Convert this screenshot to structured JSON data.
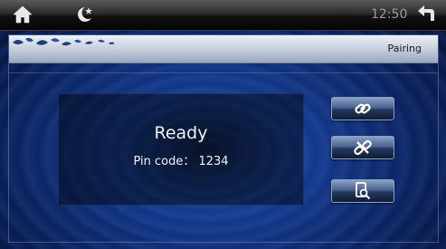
{
  "statusbar": {
    "time": "12:50",
    "icons": [
      "home-icon",
      "night-mode-icon",
      "back-arrow-icon"
    ]
  },
  "header": {
    "title": "Pairing"
  },
  "pairing": {
    "status": "Ready",
    "pin_text": "Pin code： 1234"
  },
  "actions": [
    {
      "name": "pair",
      "icon": "link-icon"
    },
    {
      "name": "unpair",
      "icon": "unlink-icon"
    },
    {
      "name": "search",
      "icon": "device-search-icon"
    }
  ],
  "colors": {
    "background": "#123585",
    "titlebar": "#c3cbd9",
    "button": "#4a638f",
    "text": "#f2f2f2"
  }
}
